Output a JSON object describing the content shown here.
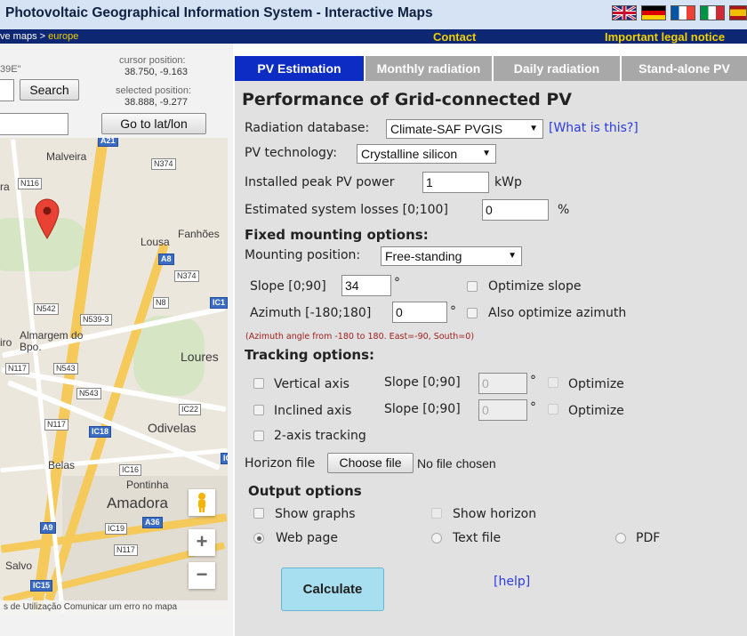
{
  "header": {
    "title": "Photovoltaic Geographical Information System - Interactive Maps",
    "flags": [
      "english-flag",
      "german-flag",
      "french-flag",
      "italian-flag",
      "spanish-flag"
    ]
  },
  "navbar": {
    "breadcrumb_prefix": "ve maps > ",
    "breadcrumb_current": "europe",
    "contact": "Contact",
    "legal": "Important legal notice"
  },
  "map_panel": {
    "coord_partial": "39E\"",
    "cursor_label": "cursor position:",
    "cursor_value": "38.750, -9.163",
    "selected_label": "selected position:",
    "selected_value": "38.888, -9.277",
    "search_button": "Search",
    "goto_button": "Go to lat/lon",
    "footer": "s de Utilização  Comunicar um erro no mapa",
    "zoom_in": "+",
    "zoom_out": "−",
    "towns": [
      "Malveira",
      "Lousa",
      "Fanhões",
      "Almargem do Bpo.",
      "Loures",
      "Odivelas",
      "Belas",
      "Pontinha",
      "Amadora",
      "Salvo",
      "ra",
      "iro"
    ],
    "road_signs": [
      "A21",
      "N374",
      "N116",
      "A8",
      "N374",
      "N8",
      "IC1",
      "N542",
      "N539-3",
      "N117",
      "N543",
      "N543",
      "IC22",
      "N117",
      "IC18",
      "IC16",
      "A36",
      "A9",
      "IC19",
      "N117",
      "IC15",
      "IC"
    ]
  },
  "tabs": [
    "PV Estimation",
    "Monthly radiation",
    "Daily radiation",
    "Stand-alone PV"
  ],
  "form": {
    "heading": "Performance of Grid-connected PV",
    "radiation_db_label": "Radiation database:",
    "radiation_db_value": "Climate-SAF PVGIS",
    "what_is_this": "[What is this?]",
    "pv_tech_label": "PV technology:",
    "pv_tech_value": "Crystalline silicon",
    "peak_power_label": "Installed peak PV power",
    "peak_power_value": "1",
    "peak_power_unit": "kWp",
    "losses_label": "Estimated system losses [0;100]",
    "losses_value": "0",
    "losses_unit": "%",
    "fixed_heading": "Fixed mounting options:",
    "mounting_label": "Mounting position:",
    "mounting_value": "Free-standing",
    "slope_label": "Slope [0;90]",
    "slope_value": "34",
    "degree": "°",
    "optimize_slope": "Optimize slope",
    "azimuth_label": "Azimuth [-180;180]",
    "azimuth_value": "0",
    "optimize_azimuth": "Also optimize azimuth",
    "azimuth_note": "(Azimuth angle from -180 to 180. East=-90, South=0)",
    "tracking_heading": "Tracking options:",
    "vertical_axis": "Vertical axis",
    "inclined_axis": "Inclined axis",
    "track_slope_label": "Slope [0;90]",
    "track_slope_value": "0",
    "optimize": "Optimize",
    "two_axis": "2-axis tracking",
    "horizon_label": "Horizon file",
    "choose_file": "Choose file",
    "no_file": "No file chosen",
    "output_heading": "Output options",
    "show_graphs": "Show graphs",
    "show_horizon": "Show horizon",
    "web_page": "Web page",
    "text_file": "Text file",
    "pdf": "PDF",
    "calculate": "Calculate",
    "help": "[help]"
  }
}
